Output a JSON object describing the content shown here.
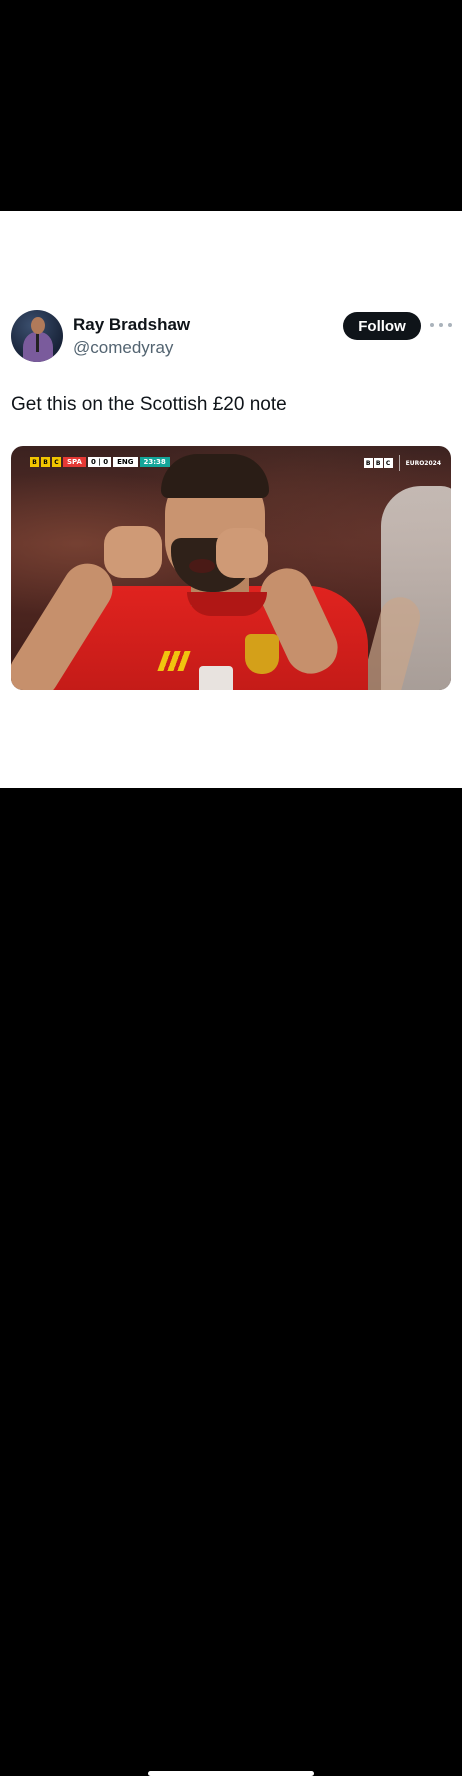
{
  "post": {
    "author_name": "Ray Bradshaw",
    "author_handle": "@comedyray",
    "follow_label": "Follow",
    "text": "Get this on the Scottish £20 note"
  },
  "media": {
    "scorebug": {
      "broadcaster_letters": [
        "B",
        "B",
        "C"
      ],
      "home_team": "SPA",
      "score": "0 | 0",
      "away_team": "ENG",
      "clock": "23:38"
    },
    "broadcaster_logo": {
      "letters": [
        "B",
        "B",
        "C"
      ],
      "tournament": "EURO2024"
    }
  },
  "colors": {
    "follow_bg": "#0f1419",
    "text_primary": "#0f1419",
    "text_secondary": "#536471",
    "home_team_bg": "#e53935",
    "clock_bg": "#14a69a",
    "bbc_yellow": "#f2c500"
  },
  "icons": {
    "more": "more-horizontal-icon"
  }
}
